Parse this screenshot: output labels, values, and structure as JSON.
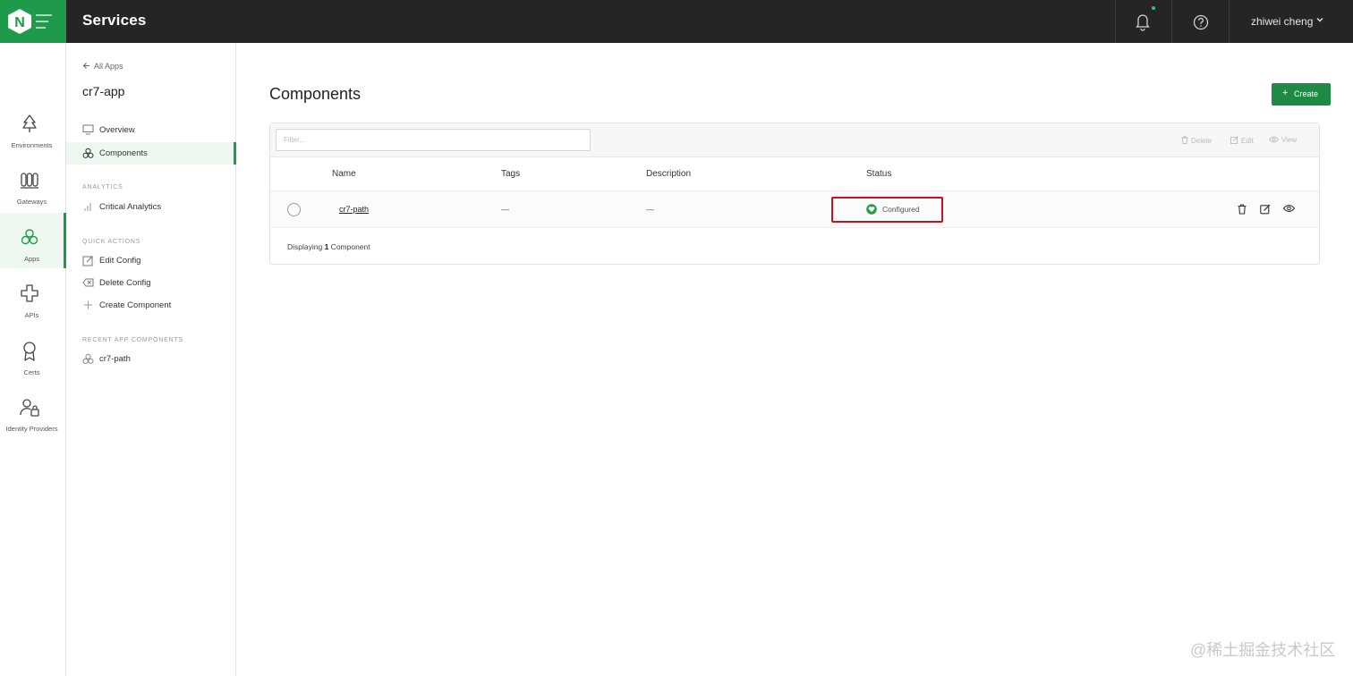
{
  "header": {
    "title": "Services",
    "user_name": "zhiwei cheng",
    "brand_color": "#1f9a4a",
    "logo_letter": "N"
  },
  "rail": {
    "items": [
      {
        "label": "Environments",
        "icon": "tree-icon"
      },
      {
        "label": "Gateways",
        "icon": "gateway-icon"
      },
      {
        "label": "Apps",
        "icon": "apps-icon",
        "active": true
      },
      {
        "label": "APIs",
        "icon": "api-icon"
      },
      {
        "label": "Certs",
        "icon": "cert-icon"
      },
      {
        "label": "Identity Providers",
        "icon": "identity-icon"
      }
    ]
  },
  "subnav": {
    "back_label": "All Apps",
    "title": "cr7-app",
    "overview": "Overview",
    "components": "Components",
    "analytics_header": "ANALYTICS",
    "critical_analytics": "Critical Analytics",
    "quick_actions_header": "QUICK ACTIONS",
    "edit_config": "Edit Config",
    "delete_config": "Delete Config",
    "create_component": "Create Component",
    "recent_header": "RECENT APP COMPONENTS",
    "recent_item": "cr7-path"
  },
  "main": {
    "title": "Components",
    "create_label": "Create",
    "filter_placeholder": "Filter...",
    "toolbar": {
      "delete": "Delete",
      "edit": "Edit",
      "view": "View"
    },
    "columns": {
      "name": "Name",
      "tags": "Tags",
      "description": "Description",
      "status": "Status"
    },
    "row": {
      "name": "cr7-path",
      "tags": "—",
      "description": "—",
      "status": "Configured"
    },
    "footer_prefix": "Displaying ",
    "footer_count": "1",
    "footer_suffix": " Component"
  },
  "watermark": "@稀土掘金技术社区"
}
